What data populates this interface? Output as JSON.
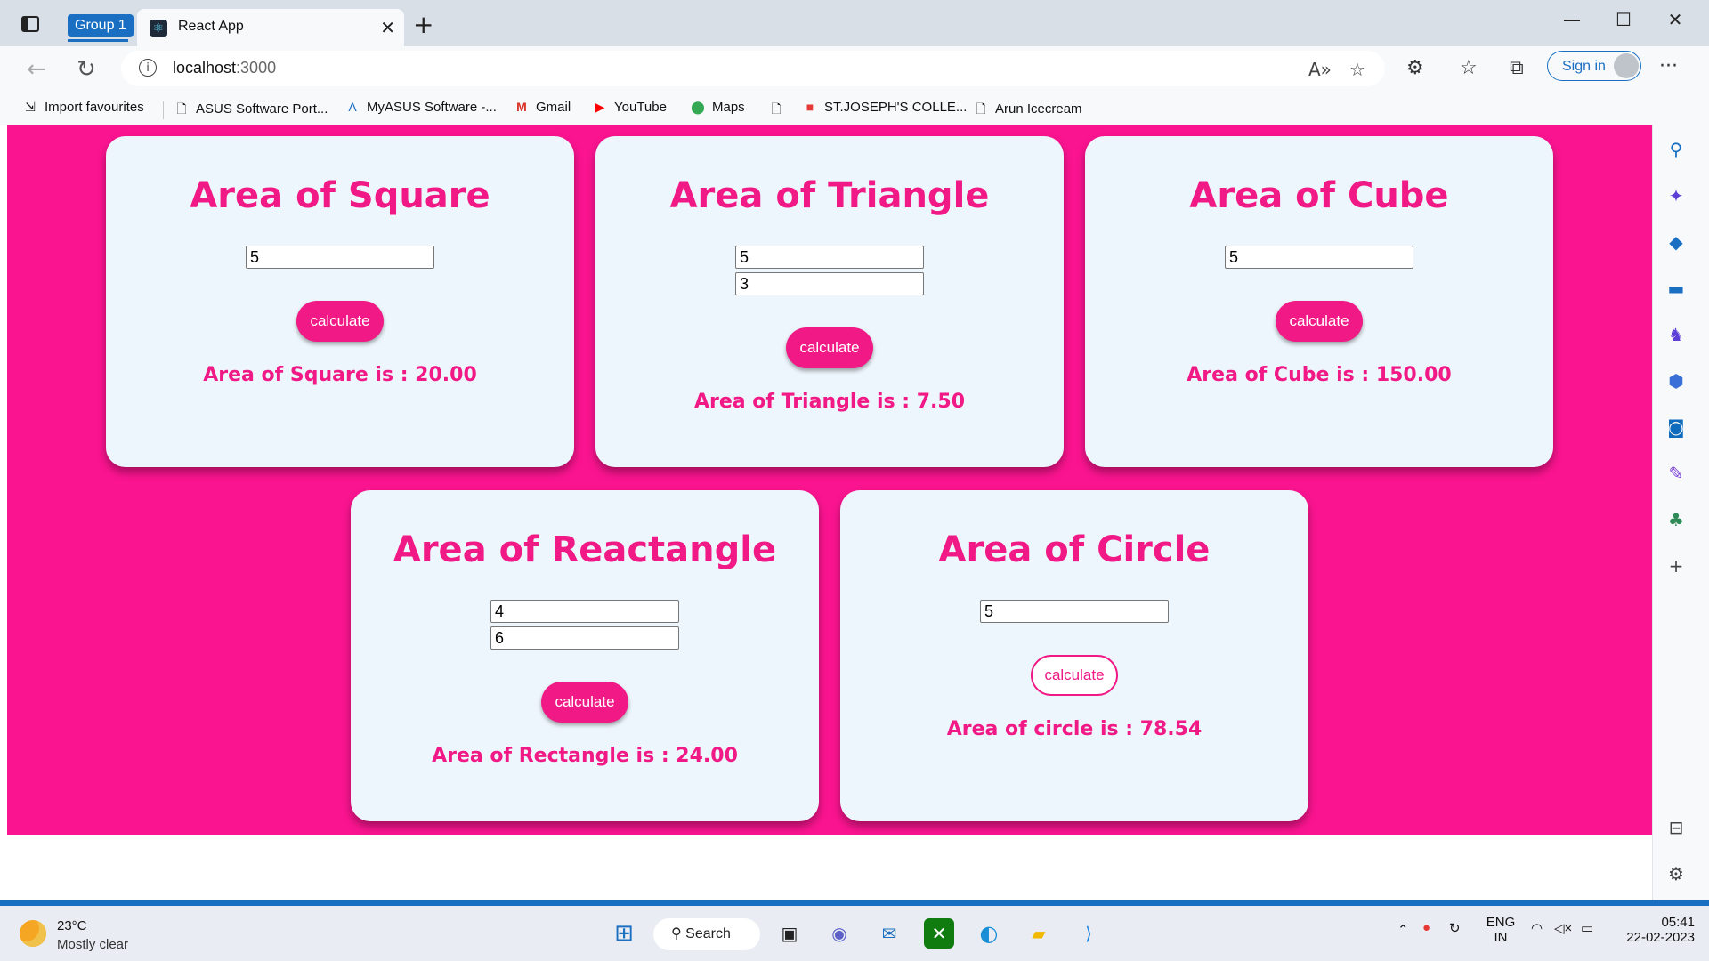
{
  "browser": {
    "group_label": "Group 1",
    "tab_title": "React App",
    "url_host": "localhost",
    "url_port": ":3000",
    "sign_in_label": "Sign in",
    "favourites": [
      {
        "label": "Import favourites",
        "icon": "import-icon"
      },
      {
        "label": "ASUS Software Port...",
        "icon": "page-icon"
      },
      {
        "label": "MyASUS Software -...",
        "icon": "myasus-icon"
      },
      {
        "label": "Gmail",
        "icon": "gmail-icon"
      },
      {
        "label": "YouTube",
        "icon": "youtube-icon"
      },
      {
        "label": "Maps",
        "icon": "maps-icon"
      },
      {
        "label": "ST.JOSEPH'S COLLE...",
        "icon": "college-icon"
      },
      {
        "label": "Arun Icecream",
        "icon": "page-icon"
      }
    ]
  },
  "app": {
    "background_color": "#fb1490",
    "accent_color": "#f01985",
    "cards": [
      {
        "title": "Area of Square",
        "inputs": [
          "5"
        ],
        "button": "calculate",
        "result": "Area of Square is : 20.00"
      },
      {
        "title": "Area of Triangle",
        "inputs": [
          "5",
          "3"
        ],
        "button": "calculate",
        "result": "Area of Triangle is : 7.50"
      },
      {
        "title": "Area of Cube",
        "inputs": [
          "5"
        ],
        "button": "calculate",
        "result": "Area of Cube is : 150.00"
      },
      {
        "title": "Area of Reactangle",
        "inputs": [
          "4",
          "6"
        ],
        "button": "calculate",
        "result": "Area of Rectangle is : 24.00"
      },
      {
        "title": "Area of Circle",
        "inputs": [
          "5"
        ],
        "button": "calculate",
        "result": "Area of circle is : 78.54"
      }
    ]
  },
  "taskbar": {
    "temperature": "23°C",
    "weather": "Mostly clear",
    "search_label": "Search",
    "lang_top": "ENG",
    "lang_bottom": "IN",
    "time": "05:41",
    "date": "22-02-2023"
  }
}
